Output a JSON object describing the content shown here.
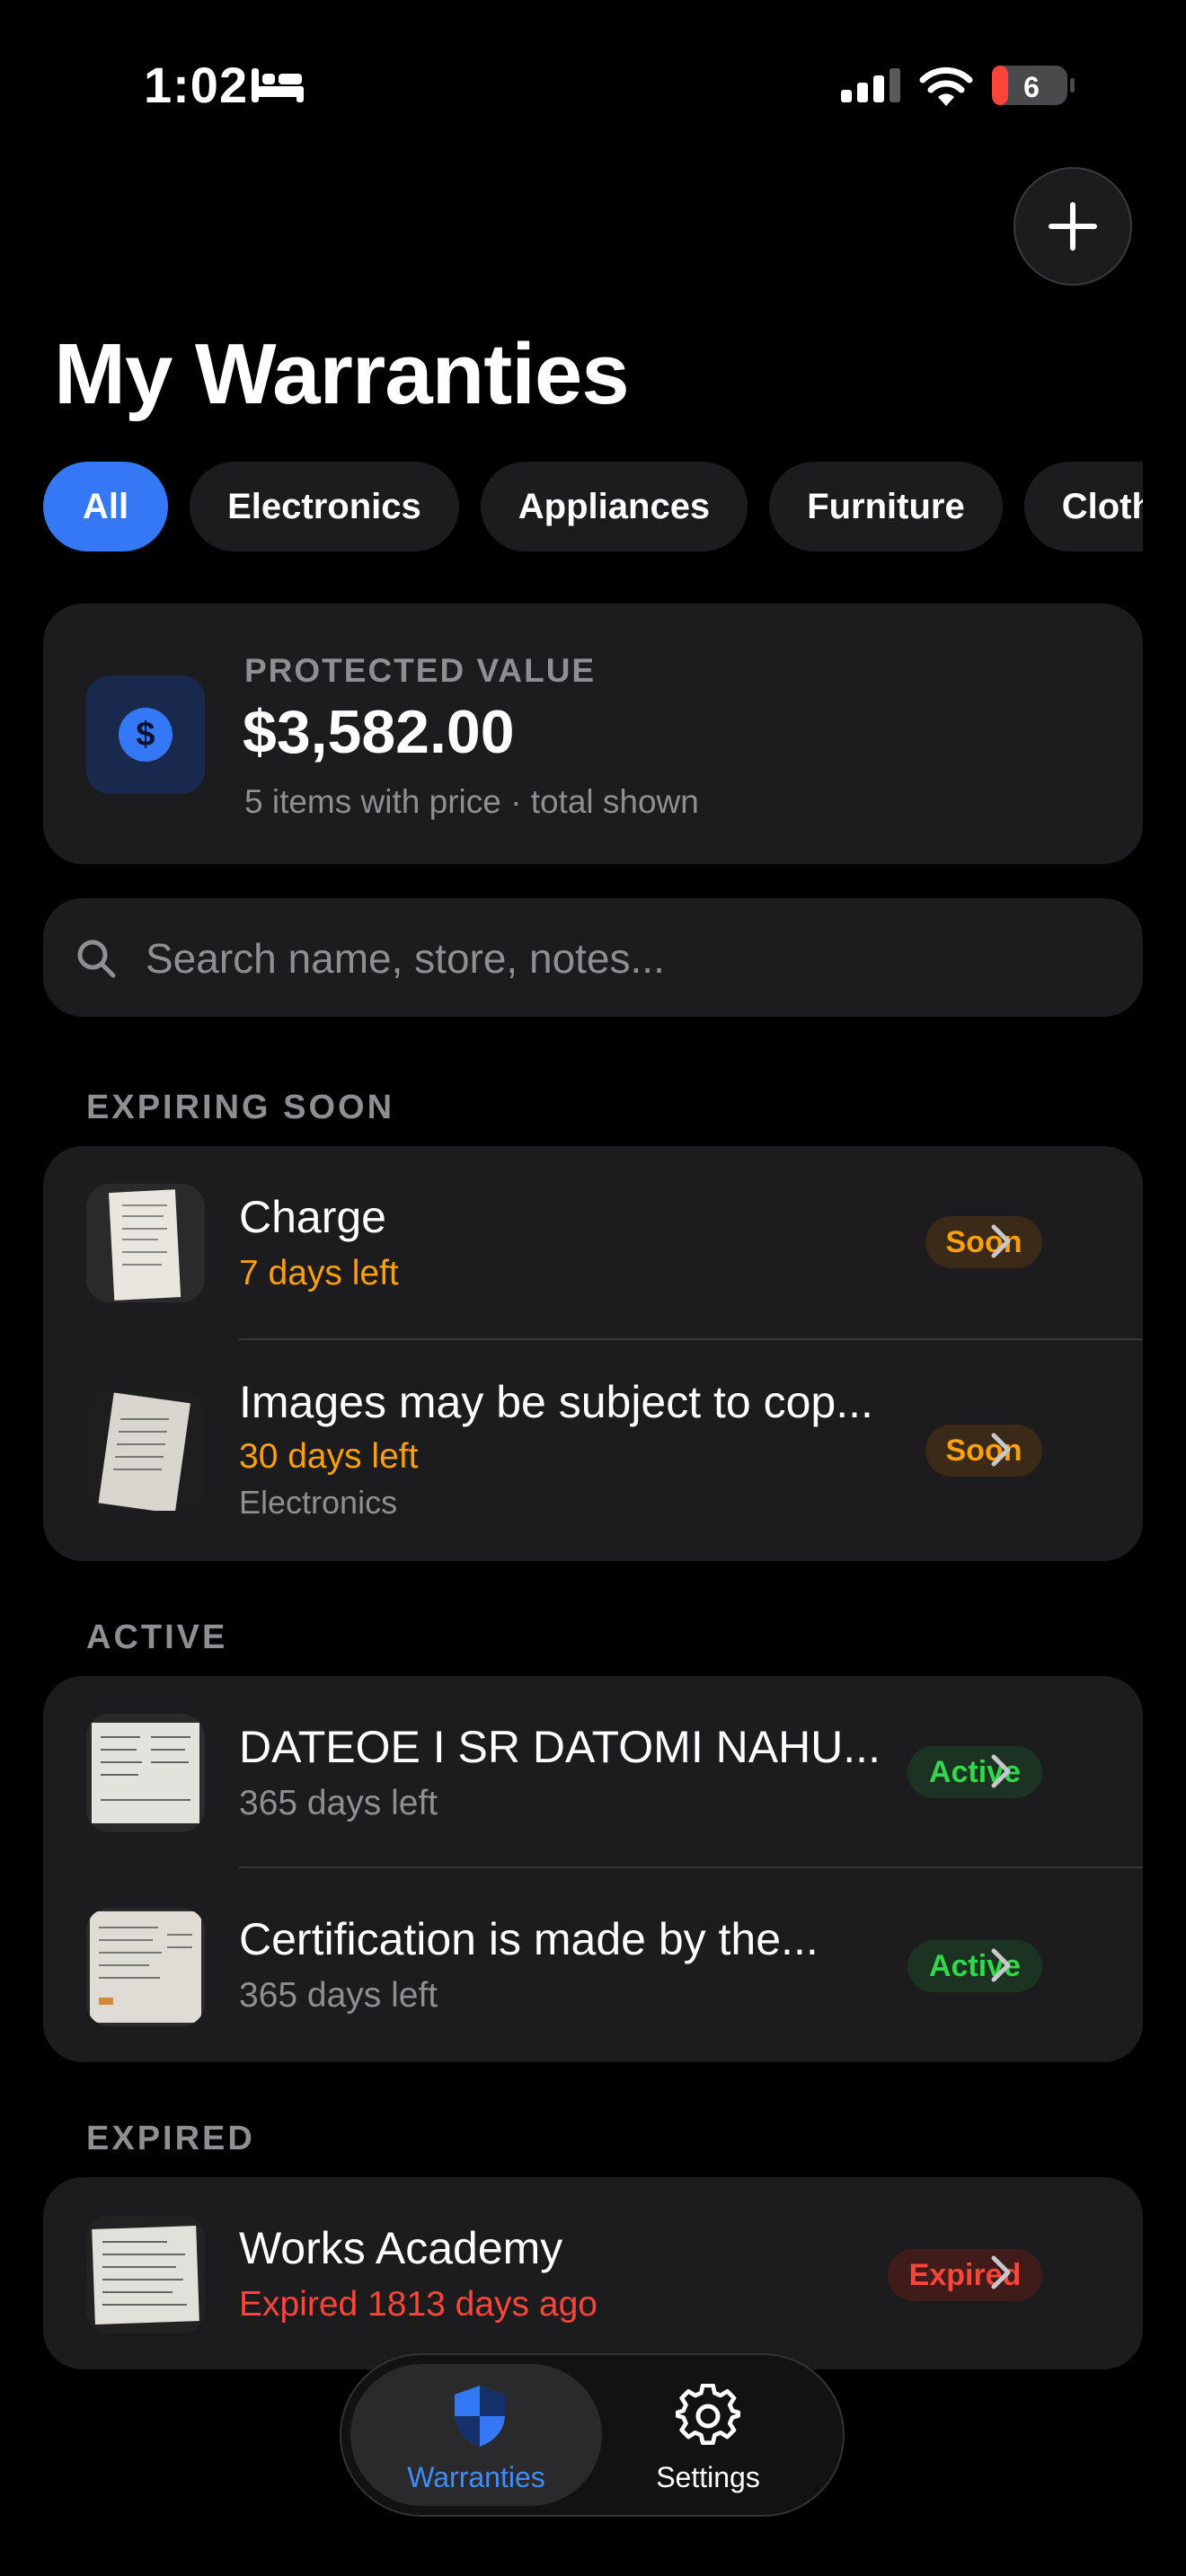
{
  "status_bar": {
    "time": "1:02",
    "battery": "6"
  },
  "header": {
    "title": "My Warranties"
  },
  "filters": [
    "All",
    "Electronics",
    "Appliances",
    "Furniture",
    "Clothing"
  ],
  "summary": {
    "label": "PROTECTED VALUE",
    "amount": "$3,582.00",
    "note": "5 items with price · total shown",
    "currency_symbol": "$"
  },
  "search": {
    "placeholder": "Search name, store, notes..."
  },
  "sections": {
    "expiring": {
      "title": "EXPIRING SOON",
      "items": [
        {
          "name": "Charge",
          "status": "7 days left",
          "badge": "Soon"
        },
        {
          "name": "Images may be subject to cop...",
          "status": "30 days left",
          "category": "Electronics",
          "badge": "Soon"
        }
      ]
    },
    "active": {
      "title": "ACTIVE",
      "items": [
        {
          "name": "DATEOE I SR DATOMI NAHU...",
          "status": "365 days left",
          "badge": "Active"
        },
        {
          "name": "Certification is made by the...",
          "status": "365 days left",
          "badge": "Active"
        }
      ]
    },
    "expired": {
      "title": "EXPIRED",
      "items": [
        {
          "name": "Works Academy",
          "status": "Expired 1813 days ago",
          "badge": "Expired"
        }
      ]
    }
  },
  "tabbar": {
    "warranties": "Warranties",
    "settings": "Settings"
  },
  "colors": {
    "accent": "#3478f6",
    "soon": "#ff9f0a",
    "active": "#32d74b",
    "expired": "#ff453a"
  },
  "icons": [
    "bed-icon",
    "signal-icon",
    "wifi-icon",
    "battery-icon",
    "plus-icon",
    "dollar-icon",
    "search-icon",
    "chevron-right-icon",
    "shield-icon",
    "gear-icon"
  ]
}
